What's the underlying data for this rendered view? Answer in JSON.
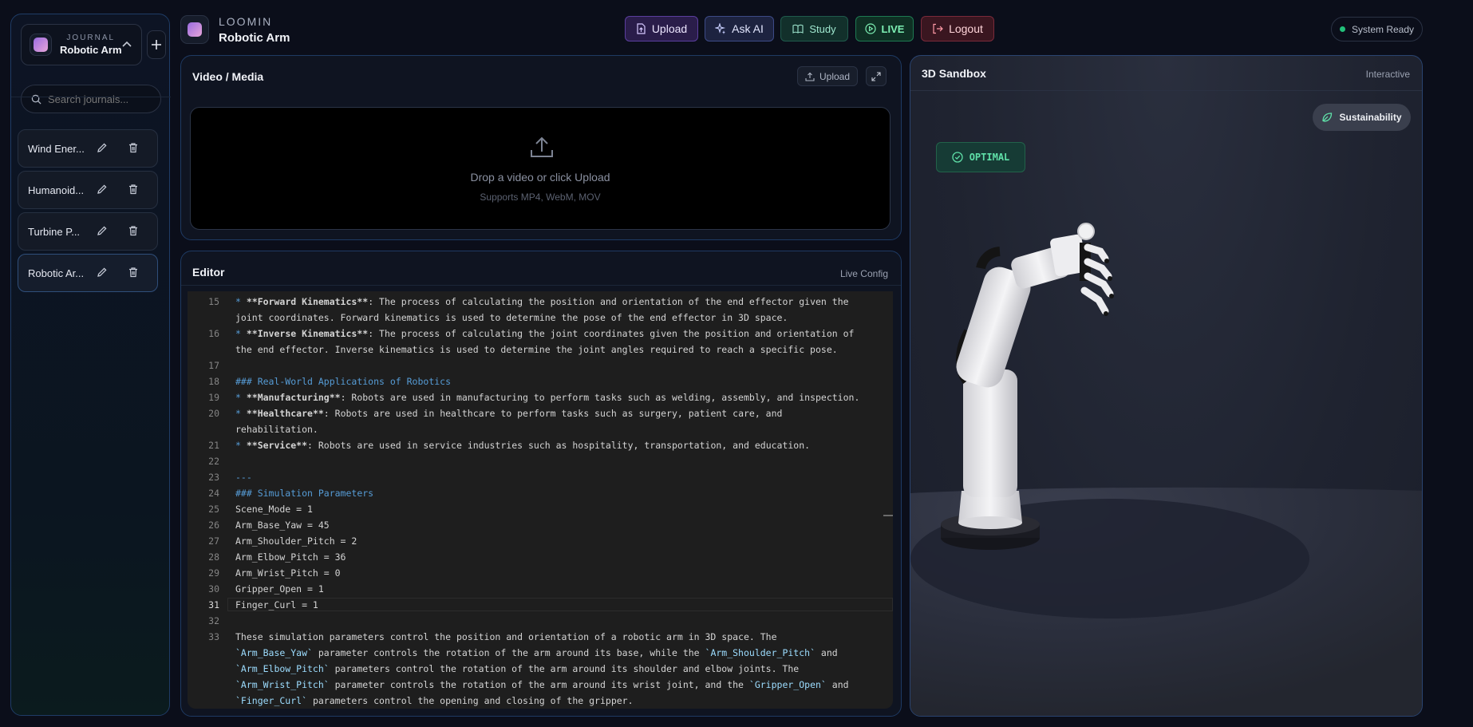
{
  "sidebar": {
    "picker_small": "JOURNAL",
    "picker_name": "Robotic Arm",
    "search_placeholder": "Search journals...",
    "journals": [
      {
        "label": "Wind Ener..."
      },
      {
        "label": "Humanoid..."
      },
      {
        "label": "Turbine P..."
      },
      {
        "label": "Robotic Ar..."
      }
    ]
  },
  "header": {
    "brand": "LOOMIN",
    "subtitle": "Robotic Arm",
    "buttons": {
      "upload": "Upload",
      "ask_ai": "Ask AI",
      "study": "Study",
      "live": "LIVE",
      "logout": "Logout"
    },
    "status": "System Ready"
  },
  "video": {
    "title": "Video / Media",
    "upload": "Upload",
    "drop_text": "Drop a video or click Upload",
    "formats": "Supports MP4, WebM, MOV"
  },
  "editor": {
    "title": "Editor",
    "mode": "Live Config",
    "lines": [
      {
        "n": "15",
        "parts": [
          [
            "* ",
            "bl"
          ],
          [
            "**Forward Kinematics**",
            "b"
          ],
          [
            ": The process of calculating the position and orientation of the end effector given the",
            ""
          ]
        ]
      },
      {
        "n": "",
        "parts": [
          [
            "joint coordinates. Forward kinematics is used to determine the pose of the end effector in 3D space.",
            ""
          ]
        ]
      },
      {
        "n": "16",
        "parts": [
          [
            "* ",
            "bl"
          ],
          [
            "**Inverse Kinematics**",
            "b"
          ],
          [
            ": The process of calculating the joint coordinates given the position and orientation of",
            ""
          ]
        ]
      },
      {
        "n": "",
        "parts": [
          [
            "the end effector. Inverse kinematics is used to determine the joint angles required to reach a specific pose.",
            ""
          ]
        ]
      },
      {
        "n": "17",
        "parts": []
      },
      {
        "n": "18",
        "parts": [
          [
            "### Real-World Applications of Robotics",
            "hd"
          ]
        ]
      },
      {
        "n": "19",
        "parts": [
          [
            "* ",
            "bl"
          ],
          [
            "**Manufacturing**",
            "b"
          ],
          [
            ": Robots are used in manufacturing to perform tasks such as welding, assembly, and inspection.",
            ""
          ]
        ]
      },
      {
        "n": "20",
        "parts": [
          [
            "* ",
            "bl"
          ],
          [
            "**Healthcare**",
            "b"
          ],
          [
            ": Robots are used in healthcare to perform tasks such as surgery, patient care, and",
            ""
          ]
        ]
      },
      {
        "n": "",
        "parts": [
          [
            "rehabilitation.",
            ""
          ]
        ]
      },
      {
        "n": "21",
        "parts": [
          [
            "* ",
            "bl"
          ],
          [
            "**Service**",
            "b"
          ],
          [
            ": Robots are used in service industries such as hospitality, transportation, and education.",
            ""
          ]
        ]
      },
      {
        "n": "22",
        "parts": []
      },
      {
        "n": "23",
        "parts": [
          [
            "---",
            "hd"
          ]
        ]
      },
      {
        "n": "24",
        "parts": [
          [
            "### Simulation Parameters",
            "hd"
          ]
        ]
      },
      {
        "n": "25",
        "parts": [
          [
            "Scene_Mode = 1",
            ""
          ]
        ]
      },
      {
        "n": "26",
        "parts": [
          [
            "Arm_Base_Yaw = 45",
            ""
          ]
        ]
      },
      {
        "n": "27",
        "parts": [
          [
            "Arm_Shoulder_Pitch = 2",
            ""
          ]
        ]
      },
      {
        "n": "28",
        "parts": [
          [
            "Arm_Elbow_Pitch = 36",
            ""
          ]
        ]
      },
      {
        "n": "29",
        "parts": [
          [
            "Arm_Wrist_Pitch = 0",
            ""
          ]
        ]
      },
      {
        "n": "30",
        "parts": [
          [
            "Gripper_Open = 1",
            ""
          ]
        ]
      },
      {
        "n": "31",
        "parts": [
          [
            "Finger_Curl = 1",
            ""
          ]
        ]
      },
      {
        "n": "32",
        "parts": []
      },
      {
        "n": "33",
        "parts": [
          [
            "These simulation parameters control the position and orientation of a robotic arm in 3D space. The",
            ""
          ]
        ]
      },
      {
        "n": "",
        "parts": [
          [
            "`Arm_Base_Yaw`",
            "bq"
          ],
          [
            " parameter controls the rotation of the arm around its base, while the ",
            ""
          ],
          [
            "`Arm_Shoulder_Pitch`",
            "bq"
          ],
          [
            " and",
            ""
          ]
        ]
      },
      {
        "n": "",
        "parts": [
          [
            "`Arm_Elbow_Pitch`",
            "bq"
          ],
          [
            " parameters control the rotation of the arm around its shoulder and elbow joints. The",
            ""
          ]
        ]
      },
      {
        "n": "",
        "parts": [
          [
            "`Arm_Wrist_Pitch`",
            "bq"
          ],
          [
            " parameter controls the rotation of the arm around its wrist joint, and the ",
            ""
          ],
          [
            "`Gripper_Open`",
            "bq"
          ],
          [
            " and",
            ""
          ]
        ]
      },
      {
        "n": "",
        "parts": [
          [
            "`Finger_Curl`",
            "bq"
          ],
          [
            " parameters control the opening and closing of the gripper.",
            ""
          ]
        ]
      }
    ],
    "current_line": "31"
  },
  "sandbox": {
    "title": "3D Sandbox",
    "mode": "Interactive",
    "sustainability": "Sustainability",
    "optimal": "OPTIMAL"
  },
  "colors": {
    "accent_purple": "#a78bfa",
    "live_green": "#22c07a",
    "logout_red": "#f87171"
  }
}
